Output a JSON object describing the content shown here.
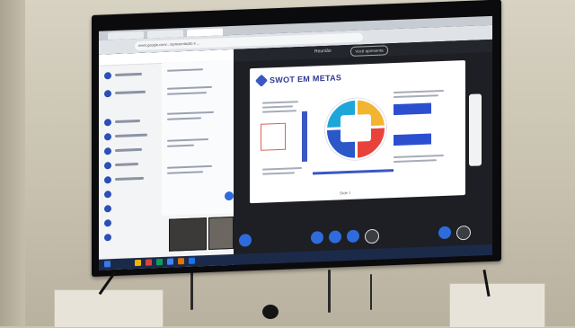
{
  "scene": {
    "description_kind": "photo of a wall-mounted TV showing a video call with a shared slide"
  },
  "browser": {
    "url": "meet.google.com/.../apresentação e ..."
  },
  "meeting": {
    "title": "Reunião",
    "share_pill": "Você apresenta"
  },
  "slide": {
    "title": "SWOT EM METAS",
    "pie_center_label": "",
    "box_top_right": "",
    "box_bottom_right": "",
    "page_indicator": "Slide 1"
  },
  "taskbar": {
    "time": "",
    "date": ""
  },
  "colors": {
    "slide_accent": "#2f3a92",
    "pie_yellow": "#f2b531",
    "pie_red": "#e8423b",
    "pie_blue": "#2c57c9",
    "pie_cyan": "#1ea6d9",
    "taskbar": "#1c2a4a"
  }
}
